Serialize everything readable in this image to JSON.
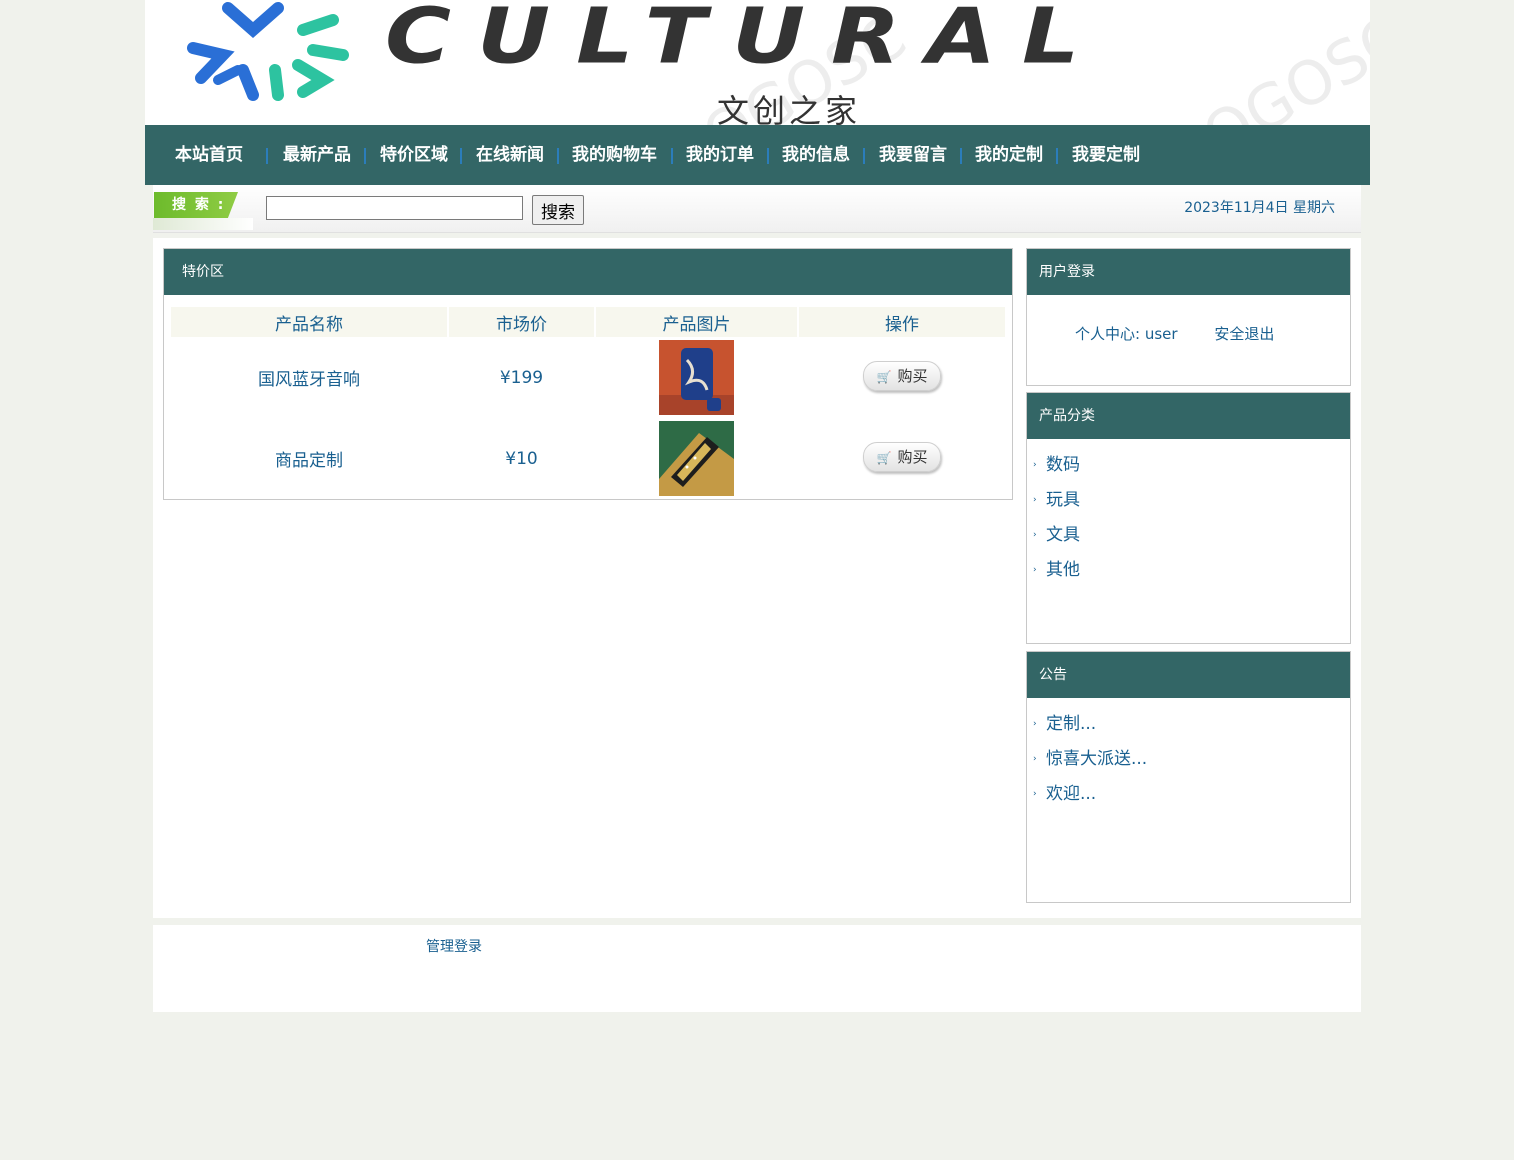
{
  "header": {
    "logo_word": "CULTURAL",
    "logo_subtitle": "文创之家",
    "watermark": "LOGOSC"
  },
  "nav": {
    "items": [
      "本站首页",
      "最新产品",
      "特价区域",
      "在线新闻",
      "我的购物车",
      "我的订单",
      "我的信息",
      "我要留言",
      "我的定制",
      "我要定制"
    ]
  },
  "search": {
    "label": "搜 索 :",
    "value": "",
    "button_label": "搜索",
    "date_text": "2023年11月4日 星期六"
  },
  "special": {
    "title": "特价区",
    "columns": [
      "产品名称",
      "市场价",
      "产品图片",
      "操作"
    ],
    "rows": [
      {
        "name": "国风蓝牙音响",
        "price": "¥199",
        "buy_label": "购买"
      },
      {
        "name": "商品定制",
        "price": "¥10",
        "buy_label": "购买"
      }
    ]
  },
  "login": {
    "title": "用户登录",
    "center_text": "个人中心: user",
    "logout_label": "安全退出"
  },
  "categories": {
    "title": "产品分类",
    "items": [
      "数码",
      "玩具",
      "文具",
      "其他"
    ]
  },
  "notices": {
    "title": "公告",
    "items": [
      "定制...",
      "惊喜大派送...",
      "欢迎..."
    ]
  },
  "footer": {
    "admin_login": "管理登录"
  },
  "colors": {
    "nav_bg": "#336666",
    "link": "#1a6090",
    "page_bg": "#f0f2ec"
  }
}
